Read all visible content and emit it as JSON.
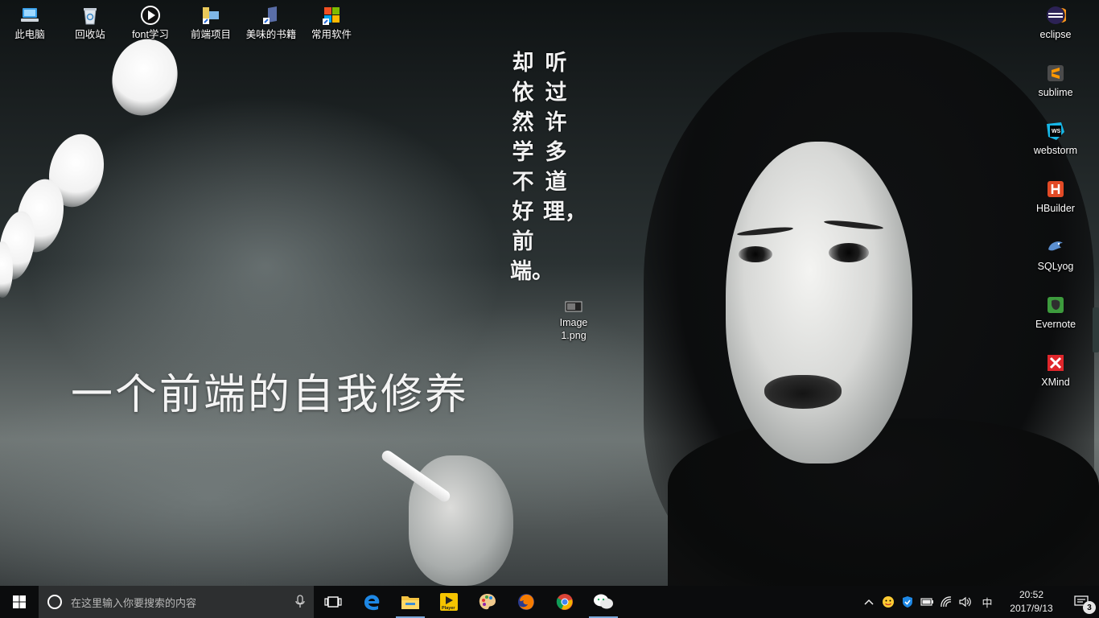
{
  "wallpaper": {
    "poem_right": "听过许多道理，",
    "poem_left": "却依然学不好前端。",
    "slogan": "一个前端的自我修养"
  },
  "desktop_left": [
    {
      "label": "此电脑",
      "icon": "computer-icon"
    },
    {
      "label": "回收站",
      "icon": "recycle-bin-icon"
    },
    {
      "label": "font学习",
      "icon": "play-circle-icon"
    },
    {
      "label": "前端项目",
      "icon": "folder-shortcut-icon"
    },
    {
      "label": "美味的书籍",
      "icon": "book-shortcut-icon"
    },
    {
      "label": "常用软件",
      "icon": "windows-shortcut-icon"
    }
  ],
  "desktop_right": [
    {
      "label": "eclipse",
      "icon": "eclipse-icon"
    },
    {
      "label": "sublime",
      "icon": "sublime-icon"
    },
    {
      "label": "webstorm",
      "icon": "webstorm-icon"
    },
    {
      "label": "HBuilder",
      "icon": "hbuilder-icon"
    },
    {
      "label": "SQLyog",
      "icon": "sqlyog-icon"
    },
    {
      "label": "Evernote",
      "icon": "evernote-icon"
    },
    {
      "label": "XMind",
      "icon": "xmind-icon"
    }
  ],
  "desktop_file": {
    "label": "Image 1.png",
    "icon": "image-file-icon"
  },
  "taskbar": {
    "search_placeholder": "在这里输入你要搜索的内容",
    "apps": [
      {
        "name": "task-view",
        "icon": "task-view-icon"
      },
      {
        "name": "edge",
        "icon": "edge-icon"
      },
      {
        "name": "file-explorer",
        "icon": "file-explorer-icon"
      },
      {
        "name": "potplayer",
        "icon": "player-icon",
        "text": "Player"
      },
      {
        "name": "paint",
        "icon": "palette-icon"
      },
      {
        "name": "firefox",
        "icon": "firefox-icon"
      },
      {
        "name": "chrome",
        "icon": "chrome-icon"
      },
      {
        "name": "wechat",
        "icon": "wechat-icon"
      }
    ],
    "ime": "中",
    "time": "20:52",
    "date": "2017/9/13",
    "notification_count": "3"
  },
  "colors": {
    "taskbar": "#0b0c0d",
    "search_box": "#2d2f30",
    "active_underline": "#7aa7d8"
  }
}
